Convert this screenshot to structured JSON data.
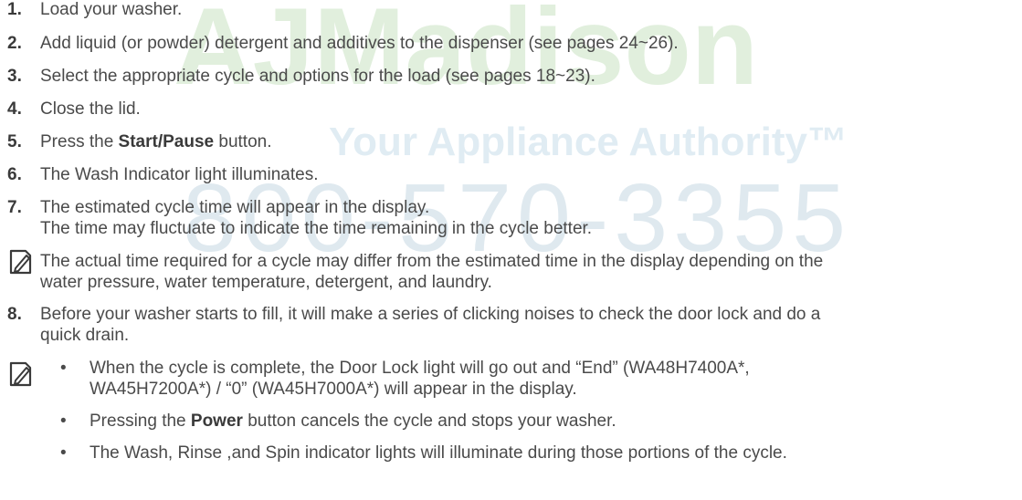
{
  "watermark": {
    "brand": "AJMadison",
    "tagline": "Your Appliance Authority™",
    "phone": "800-570-3355"
  },
  "steps": [
    {
      "num": "1.",
      "pre": "Load your washer.",
      "bold": "",
      "post": ""
    },
    {
      "num": "2.",
      "pre": "Add liquid (or powder) detergent and additives to the dispenser (see pages 24~26).",
      "bold": "",
      "post": ""
    },
    {
      "num": "3.",
      "pre": "Select the appropriate cycle and options for the load (see pages 18~23).",
      "bold": "",
      "post": ""
    },
    {
      "num": "4.",
      "pre": "Close the lid.",
      "bold": "",
      "post": ""
    },
    {
      "num": "5.",
      "pre": "Press the ",
      "bold": "Start/Pause",
      "post": " button."
    },
    {
      "num": "6.",
      "pre": "The Wash Indicator light illuminates.",
      "bold": "",
      "post": ""
    },
    {
      "num": "7.",
      "pre": "The estimated cycle time will appear in the display.",
      "bold": "",
      "post": ""
    }
  ],
  "step7_cont": "The time may fluctuate to indicate the time remaining in the cycle better.",
  "note1": {
    "icon": "note-pencil-icon",
    "line1": "The actual time required for a cycle may differ from the estimated time in the display depending on the",
    "line2": "water pressure, water temperature, detergent, and laundry."
  },
  "step8": {
    "num": "8.",
    "line1": "Before your washer starts to fill, it will make a series of clicking noises to check the door lock and do a",
    "line2": "quick drain."
  },
  "note2": {
    "icon": "note-pencil-icon",
    "bullets": [
      {
        "line1": "When the cycle is complete, the Door Lock light will go out and “End” (WA48H7400A*,",
        "line2": "WA45H7200A*) / “0” (WA45H7000A*) will appear in the display.",
        "pre": "",
        "bold": "",
        "post": ""
      },
      {
        "line1": "",
        "line2": "",
        "pre": "Pressing the ",
        "bold": "Power",
        "post": " button cancels the cycle and stops your washer."
      },
      {
        "line1": "The Wash, Rinse ,and Spin indicator lights will illuminate during those portions of the cycle.",
        "line2": "",
        "pre": "",
        "bold": "",
        "post": ""
      }
    ],
    "bullet_char": "•"
  }
}
